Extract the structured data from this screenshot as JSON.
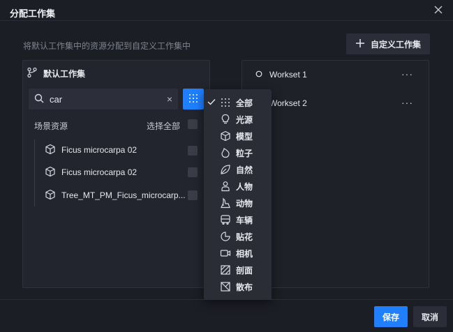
{
  "dialog": {
    "title": "分配工作集",
    "subtitle": "将默认工作集中的资源分配到自定义工作集中",
    "add_custom_label": "自定义工作集"
  },
  "left_panel": {
    "title": "默认工作集",
    "search": {
      "value": "car",
      "placeholder": ""
    },
    "column_header": "场景资源",
    "select_all_label": "选择全部",
    "items": [
      {
        "label": "Ficus microcarpa 02"
      },
      {
        "label": "Ficus microcarpa 02"
      },
      {
        "label": "Tree_MT_PM_Ficus_microcarp..."
      }
    ]
  },
  "right_panel": {
    "worksets": [
      {
        "label": "Workset 1",
        "more": "···"
      },
      {
        "label": "Workset 2",
        "more": "···"
      }
    ]
  },
  "filter_menu": {
    "items": [
      {
        "label": "全部",
        "icon": "grid-icon",
        "checked": true
      },
      {
        "label": "光源",
        "icon": "lightbulb-icon"
      },
      {
        "label": "模型",
        "icon": "cube-icon"
      },
      {
        "label": "粒子",
        "icon": "flame-icon"
      },
      {
        "label": "自然",
        "icon": "leaf-icon"
      },
      {
        "label": "人物",
        "icon": "person-icon"
      },
      {
        "label": "动物",
        "icon": "animal-icon"
      },
      {
        "label": "车辆",
        "icon": "bus-icon"
      },
      {
        "label": "贴花",
        "icon": "decal-icon"
      },
      {
        "label": "相机",
        "icon": "camera-icon"
      },
      {
        "label": "剖面",
        "icon": "section-icon"
      },
      {
        "label": "散布",
        "icon": "scatter-icon"
      }
    ]
  },
  "footer": {
    "save_label": "保存",
    "cancel_label": "取消"
  },
  "colors": {
    "background": "#1c1e25",
    "accent": "#1f7fff",
    "panel": "#22252d"
  }
}
